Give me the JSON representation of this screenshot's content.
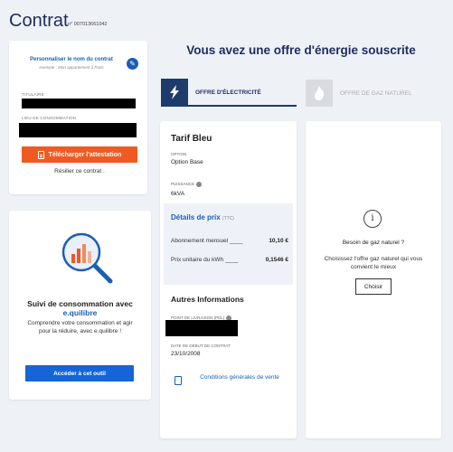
{
  "header": {
    "title": "Contrat",
    "contract_number": "n° 007013661042"
  },
  "contract": {
    "personalize_label": "Personnaliser le nom du contrat",
    "personalize_example": "exemple : Mon appartement à Paris",
    "holder_label": "TITULAIRE",
    "location_label": "LIEU DE CONSOMMATION",
    "download_label": "Télécharger l'attestation",
    "cancel_label": "Résilier ce contrat ."
  },
  "consumption": {
    "title_prefix": "Suivi de consommation avec ",
    "brand": "e.quilibre",
    "description": "Comprendre votre consommation et agir pour la réduire, avec e.quilibre !",
    "button_label": "Accéder à cet outil"
  },
  "offers": {
    "heading": "Vous avez une offre d'énergie souscrite",
    "tab_electricity": "OFFRE D'ÉLECTRICITÉ",
    "tab_gas": "OFFRE DE GAZ NATUREL"
  },
  "electricity": {
    "tarif_name": "Tarif Bleu",
    "option_label": "OPTION",
    "option_value": "Option Base",
    "power_label": "PUISSANCE",
    "power_value": "6kVA",
    "price_title": "Détails de prix",
    "price_ttc": "(TTC)",
    "subscription_label": "Abonnement mensuel ____",
    "subscription_value": "10,10 €",
    "unit_price_label": "Prix unitaire du kWh ____",
    "unit_price_value": "0,1546 €",
    "other_title": "Autres Informations",
    "delivery_point_label": "POINT DE LIVRAISON (PDL)",
    "start_date_label": "DATE DE DÉBUT DE CONTRAT",
    "start_date_value": "23/10/2008",
    "cgv_label": "Conditions générales de vente"
  },
  "gas": {
    "question": "Besoin de gaz naturel ?",
    "description": "Choisissez l'offre gaz naturel qui vous convient le mieux",
    "choose_label": "Choisir"
  },
  "colors": {
    "accent_blue": "#1a5fb4",
    "navy": "#1d2d5c",
    "orange": "#ef5a23",
    "background": "#eef1f6"
  }
}
